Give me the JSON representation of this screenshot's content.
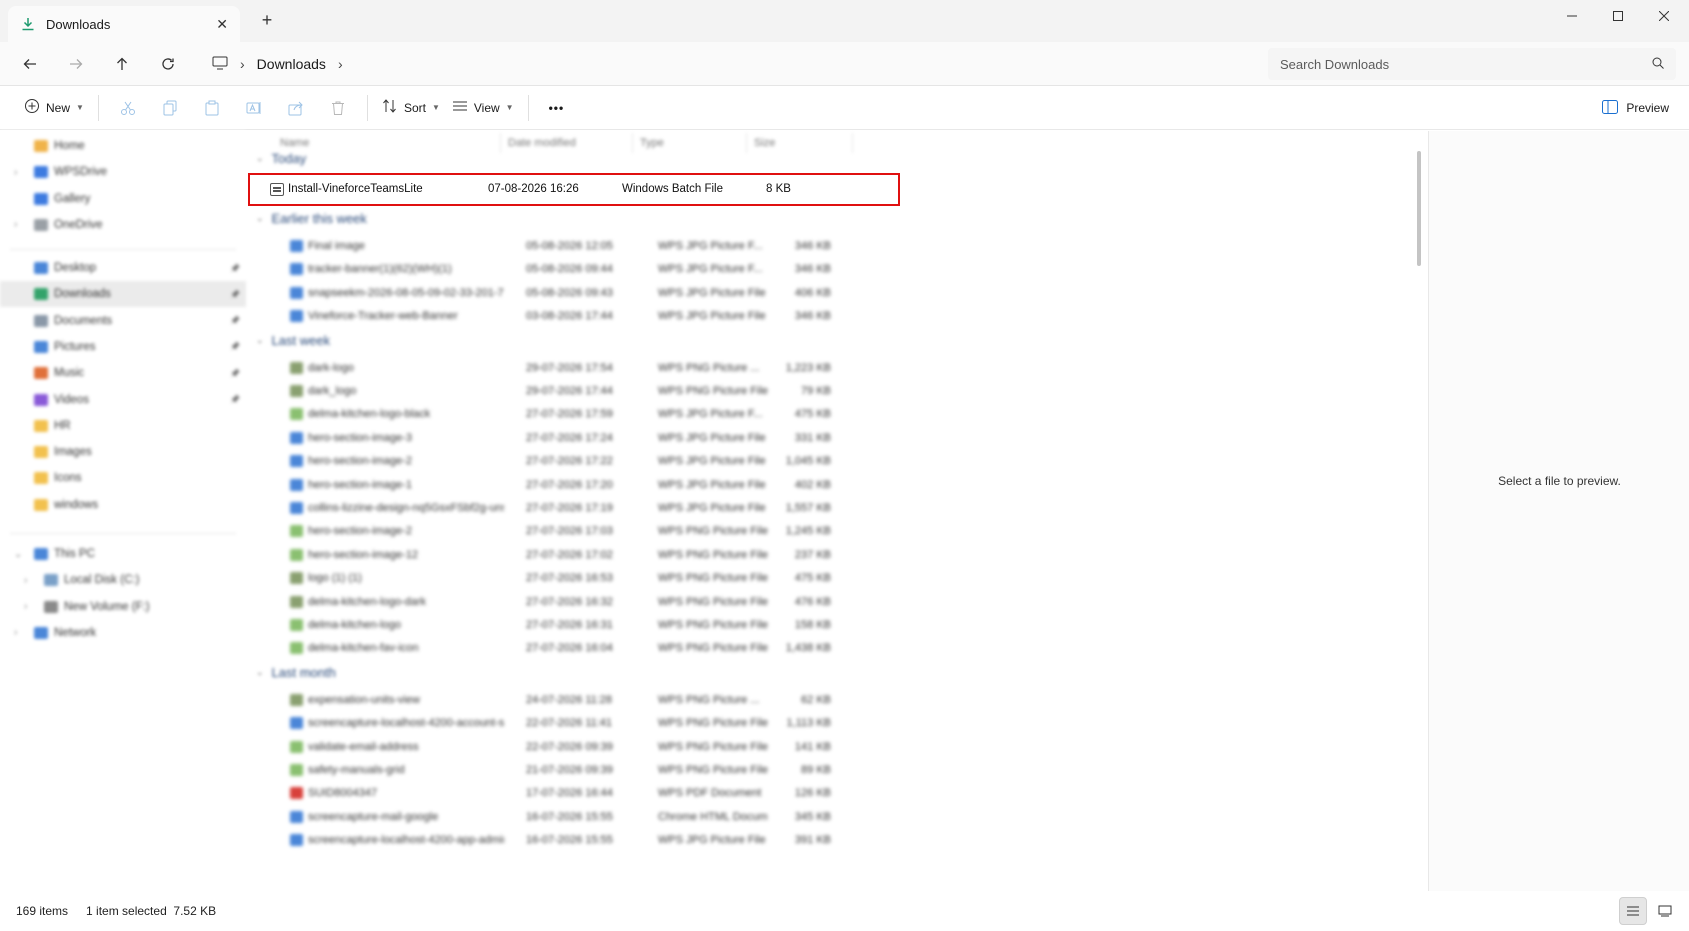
{
  "window": {
    "tab_title": "Downloads",
    "new_tab_label": "+",
    "tab_close_label": "✕"
  },
  "nav": {
    "breadcrumb": [
      "Downloads"
    ],
    "search_placeholder": "Search Downloads"
  },
  "commandbar": {
    "new_label": "New",
    "sort_label": "Sort",
    "view_label": "View",
    "more_label": "•••",
    "preview_label": "Preview"
  },
  "sidebar": {
    "quick": [
      {
        "label": "Home",
        "icon": "home-icon",
        "color": "#f0b34a",
        "chevron": false
      },
      {
        "label": "WPSDrive",
        "icon": "cloud-icon",
        "color": "#3d7be0",
        "chevron": true
      },
      {
        "label": "Gallery",
        "icon": "gallery-icon",
        "color": "#3d7be0",
        "chevron": false
      },
      {
        "label": "OneDrive",
        "icon": "onedrive-icon",
        "color": "#9aa0a6",
        "chevron": true
      }
    ],
    "pinned": [
      {
        "label": "Desktop",
        "icon": "desktop-icon",
        "color": "#4a86d8",
        "pinned": true,
        "selected": false
      },
      {
        "label": "Downloads",
        "icon": "downloads-icon",
        "color": "#33a36a",
        "pinned": true,
        "selected": true
      },
      {
        "label": "Documents",
        "icon": "documents-icon",
        "color": "#8a98a8",
        "pinned": true,
        "selected": false
      },
      {
        "label": "Pictures",
        "icon": "pictures-icon",
        "color": "#4a86d8",
        "pinned": true,
        "selected": false
      },
      {
        "label": "Music",
        "icon": "music-icon",
        "color": "#e0703a",
        "pinned": true,
        "selected": false
      },
      {
        "label": "Videos",
        "icon": "videos-icon",
        "color": "#8a5ad8",
        "pinned": true,
        "selected": false
      },
      {
        "label": "HR",
        "icon": "folder-icon",
        "color": "#f2c14e",
        "pinned": false,
        "selected": false
      },
      {
        "label": "Images",
        "icon": "folder-icon",
        "color": "#f2c14e",
        "pinned": false,
        "selected": false
      },
      {
        "label": "Icons",
        "icon": "folder-icon",
        "color": "#f2c14e",
        "pinned": false,
        "selected": false
      },
      {
        "label": "windows",
        "icon": "folder-icon",
        "color": "#f2c14e",
        "pinned": false,
        "selected": false
      }
    ],
    "devices": [
      {
        "label": "This PC",
        "icon": "pc-icon",
        "color": "#4a86d8",
        "indent": 0,
        "chevron": "down"
      },
      {
        "label": "Local Disk (C:)",
        "icon": "drive-icon",
        "color": "#7aa0c8",
        "indent": 1,
        "chevron": "right"
      },
      {
        "label": "New Volume (F:)",
        "icon": "drive-icon",
        "color": "#8a8a8a",
        "indent": 1,
        "chevron": "right"
      },
      {
        "label": "Network",
        "icon": "network-icon",
        "color": "#4a86d8",
        "indent": 0,
        "chevron": "right"
      }
    ]
  },
  "filelist": {
    "columns": {
      "name": "Name",
      "date": "Date modified",
      "type": "Type",
      "size": "Size"
    },
    "groups": [
      {
        "label": "Today",
        "rows": [
          {
            "name": "Install-VineforceTeamsLite",
            "date": "07-08-2026 16:26",
            "type": "Windows Batch File",
            "size": "8 KB",
            "icon": "batch-file-icon",
            "color": "#555555",
            "selected": true
          }
        ]
      },
      {
        "label": "Earlier this week",
        "rows": [
          {
            "name": "Final image",
            "date": "05-08-2026 12:05",
            "type": "WPS JPG Picture F...",
            "size": "346 KB",
            "icon": "image-file-icon",
            "color": "#4a86d8"
          },
          {
            "name": "tracker-banner(1)(62)(WH)(1)",
            "date": "05-08-2026 09:44",
            "type": "WPS JPG Picture F...",
            "size": "346 KB",
            "icon": "image-file-icon",
            "color": "#4a86d8"
          },
          {
            "name": "snapseekm-2026-08-05-09-02-33-201-7f(2)",
            "date": "05-08-2026 09:43",
            "type": "WPS JPG Picture File",
            "size": "406 KB",
            "icon": "image-file-icon",
            "color": "#4a86d8"
          },
          {
            "name": "Vineforce-Tracker-web-Banner",
            "date": "03-08-2026 17:44",
            "type": "WPS JPG Picture File",
            "size": "346 KB",
            "icon": "image-file-icon",
            "color": "#4a86d8"
          }
        ]
      },
      {
        "label": "Last week",
        "rows": [
          {
            "name": "dark-logo",
            "date": "29-07-2026 17:54",
            "type": "WPS PNG Picture ...",
            "size": "1,223 KB",
            "icon": "png-file-icon",
            "color": "#8aa070"
          },
          {
            "name": "dark_logo",
            "date": "29-07-2026 17:44",
            "type": "WPS PNG Picture File",
            "size": "79 KB",
            "icon": "png-file-icon",
            "color": "#8aa070"
          },
          {
            "name": "delma-kitchen-logo-black",
            "date": "27-07-2026 17:59",
            "type": "WPS JPG Picture F...",
            "size": "475 KB",
            "icon": "png-file-icon",
            "color": "#8ac070"
          },
          {
            "name": "hero-section-image-3",
            "date": "27-07-2026 17:24",
            "type": "WPS JPG Picture File",
            "size": "331 KB",
            "icon": "image-file-icon",
            "color": "#4a86d8"
          },
          {
            "name": "hero-section-image-2",
            "date": "27-07-2026 17:22",
            "type": "WPS JPG Picture File",
            "size": "1,045 KB",
            "icon": "image-file-icon",
            "color": "#4a86d8"
          },
          {
            "name": "hero-section-image-1",
            "date": "27-07-2026 17:20",
            "type": "WPS JPG Picture File",
            "size": "402 KB",
            "icon": "image-file-icon",
            "color": "#4a86d8"
          },
          {
            "name": "collins-lizzine-design-nq5GsxFSbf2g-unsp...",
            "date": "27-07-2026 17:19",
            "type": "WPS JPG Picture File",
            "size": "1,557 KB",
            "icon": "image-file-icon",
            "color": "#4a86d8"
          },
          {
            "name": "hero-section-image-2",
            "date": "27-07-2026 17:03",
            "type": "WPS PNG Picture File",
            "size": "1,245 KB",
            "icon": "png-file-icon",
            "color": "#8ac070"
          },
          {
            "name": "hero-section-image-12",
            "date": "27-07-2026 17:02",
            "type": "WPS PNG Picture File",
            "size": "237 KB",
            "icon": "png-file-icon",
            "color": "#8ac070"
          },
          {
            "name": "logo (1) (1)",
            "date": "27-07-2026 16:53",
            "type": "WPS PNG Picture File",
            "size": "475 KB",
            "icon": "png-file-icon",
            "color": "#8aa070"
          },
          {
            "name": "delma-kitchen-logo-dark",
            "date": "27-07-2026 16:32",
            "type": "WPS PNG Picture File",
            "size": "476 KB",
            "icon": "png-file-icon",
            "color": "#8aa070"
          },
          {
            "name": "delma-kitchen-logo",
            "date": "27-07-2026 16:31",
            "type": "WPS PNG Picture File",
            "size": "158 KB",
            "icon": "png-file-icon",
            "color": "#8ac070"
          },
          {
            "name": "delma-kitchen-fav-icon",
            "date": "27-07-2026 16:04",
            "type": "WPS PNG Picture File",
            "size": "1,438 KB",
            "icon": "png-file-icon",
            "color": "#8ac070"
          }
        ]
      },
      {
        "label": "Last month",
        "rows": [
          {
            "name": "expensation-units-view",
            "date": "24-07-2026 11:28",
            "type": "WPS PNG Picture ...",
            "size": "62 KB",
            "icon": "png-file-icon",
            "color": "#8aa070"
          },
          {
            "name": "screencapture-localhost-4200-account-s...",
            "date": "22-07-2026 11:41",
            "type": "WPS PNG Picture File",
            "size": "1,113 KB",
            "icon": "image-file-icon",
            "color": "#4a86d8"
          },
          {
            "name": "validate-email-address",
            "date": "22-07-2026 09:39",
            "type": "WPS PNG Picture File",
            "size": "141 KB",
            "icon": "png-file-icon",
            "color": "#8ac070"
          },
          {
            "name": "safety-manuals-grid",
            "date": "21-07-2026 09:39",
            "type": "WPS PNG Picture File",
            "size": "89 KB",
            "icon": "png-file-icon",
            "color": "#8ac070"
          },
          {
            "name": "SUID8004347",
            "date": "17-07-2026 16:44",
            "type": "WPS PDF Document",
            "size": "126 KB",
            "icon": "pdf-file-icon",
            "color": "#d8403a"
          },
          {
            "name": "screencapture-mail-google",
            "date": "16-07-2026 15:55",
            "type": "Chrome HTML Docum...",
            "size": "345 KB",
            "icon": "html-file-icon",
            "color": "#4a86d8"
          },
          {
            "name": "screencapture-localhost-4200-app-admin...",
            "date": "16-07-2026 15:55",
            "type": "WPS JPG Picture File",
            "size": "391 KB",
            "icon": "image-file-icon",
            "color": "#4a86d8"
          }
        ]
      }
    ]
  },
  "preview": {
    "message": "Select a file to preview."
  },
  "status": {
    "item_count": "169 items",
    "selection": "1 item selected  7.52 KB"
  }
}
